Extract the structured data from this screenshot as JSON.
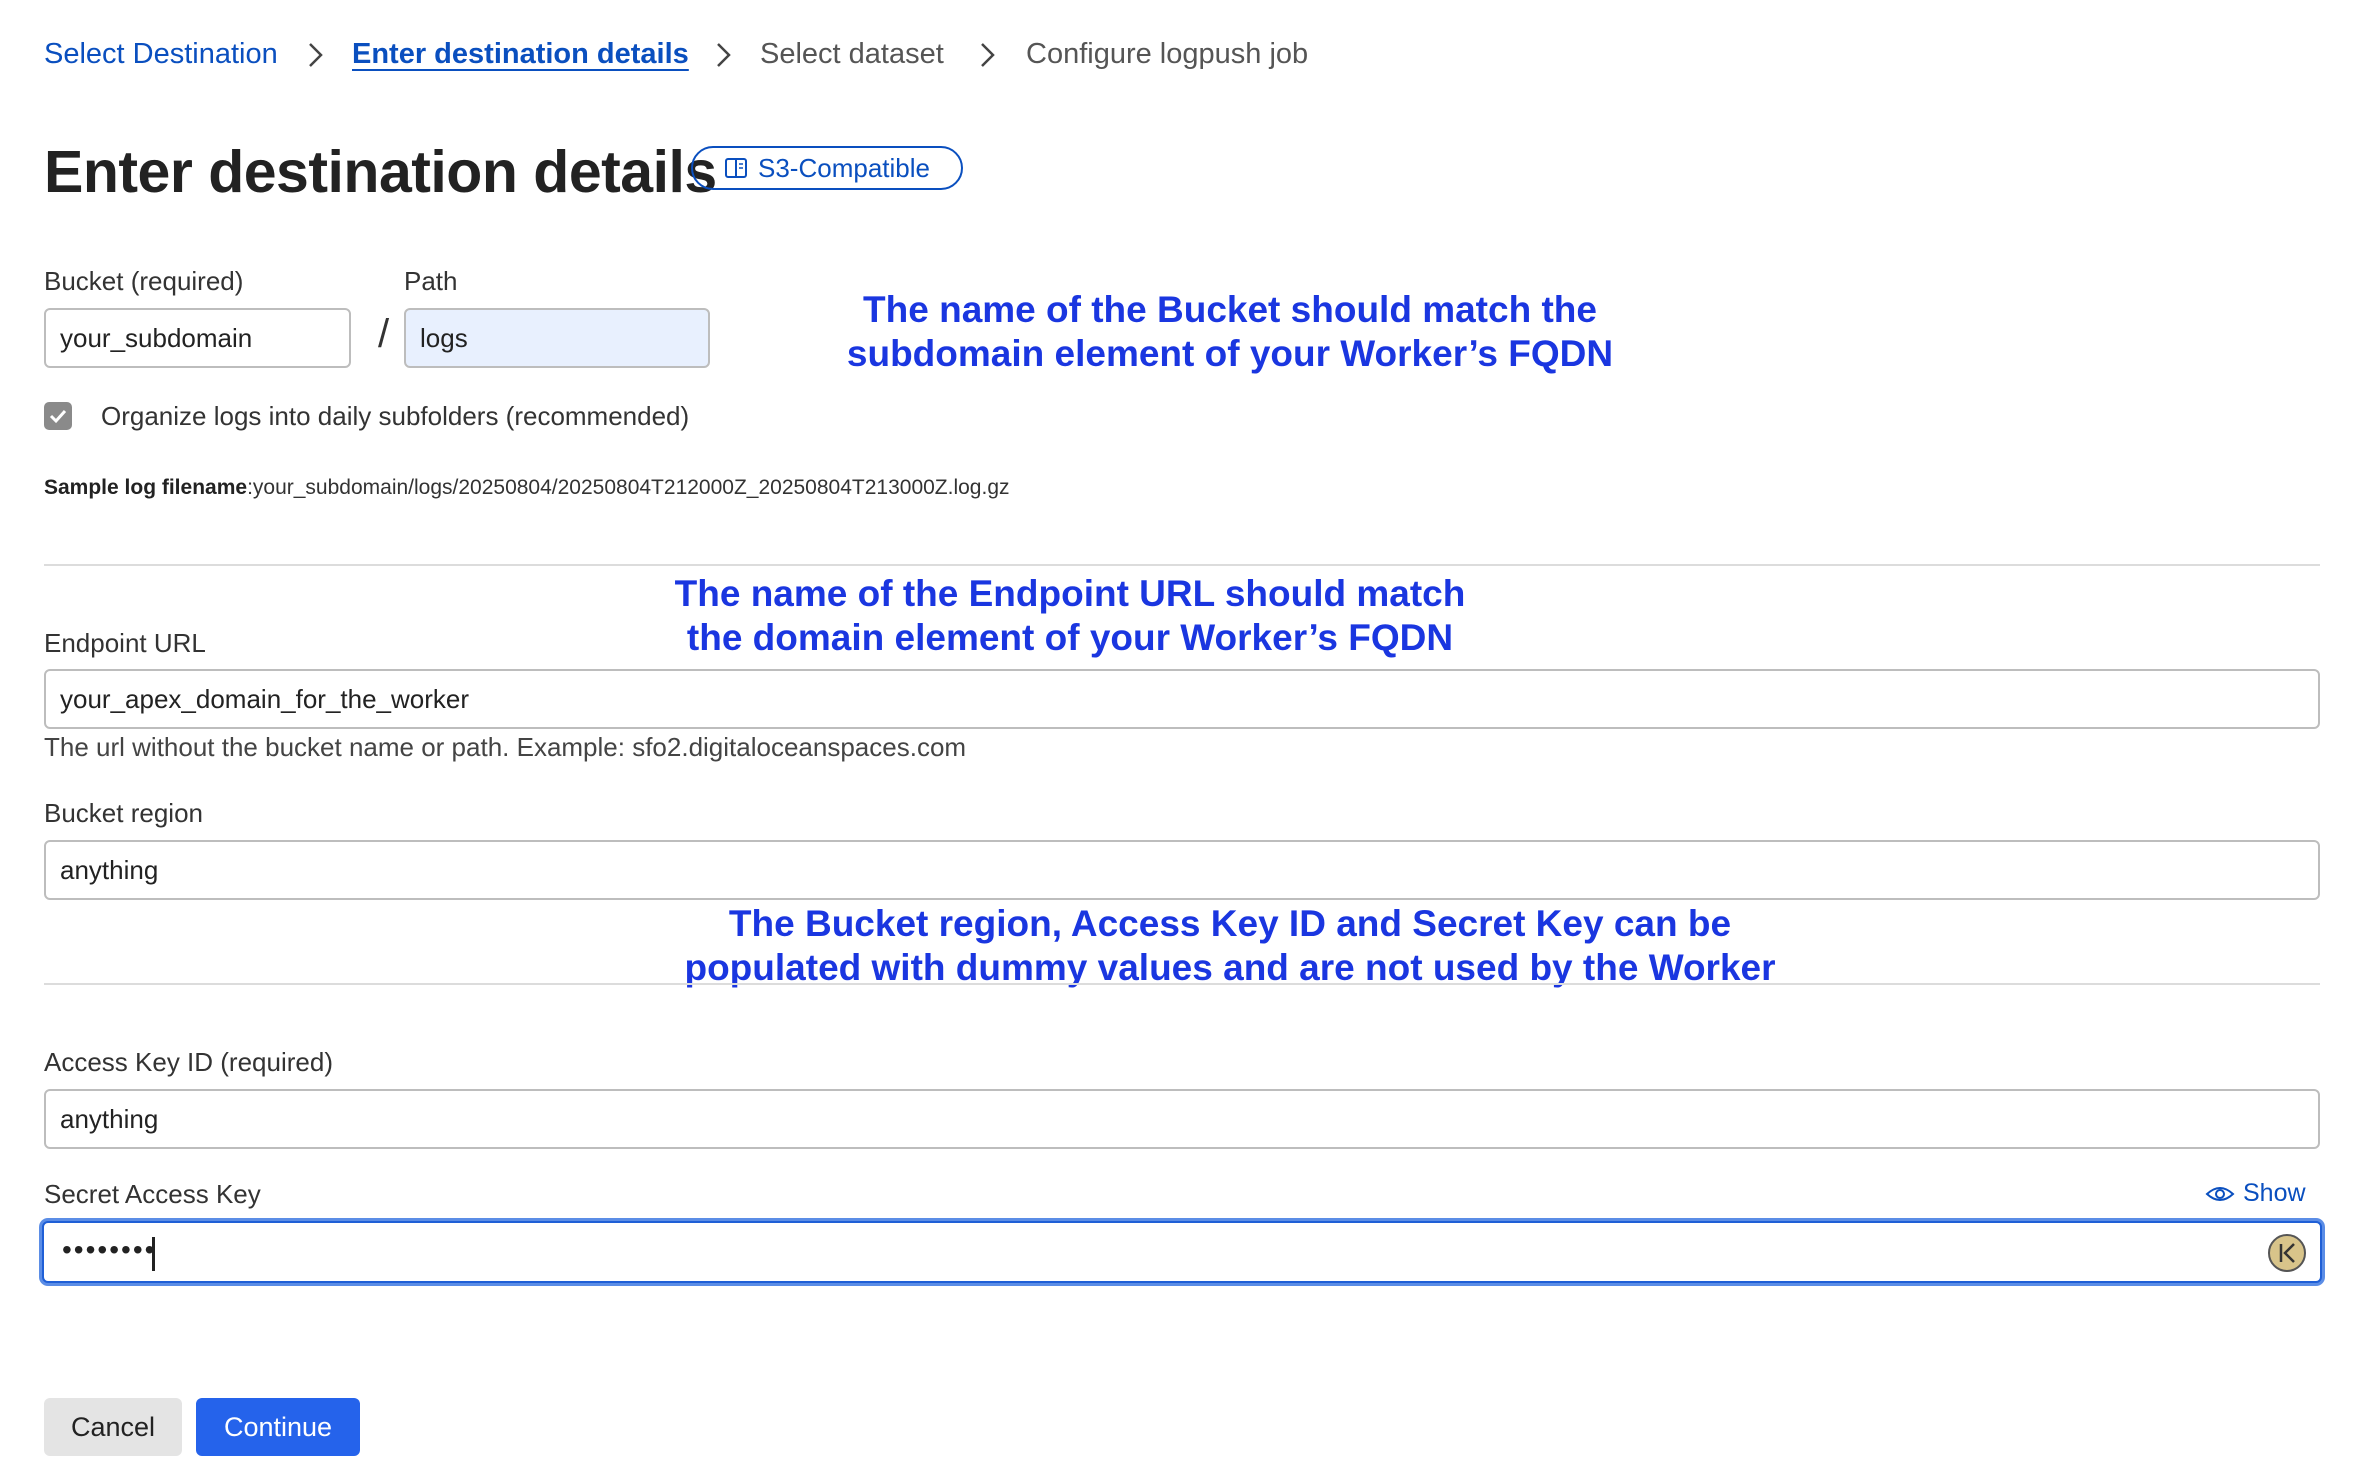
{
  "breadcrumb": {
    "items": [
      {
        "label": "Select Destination",
        "state": "link"
      },
      {
        "label": "Enter destination details",
        "state": "current"
      },
      {
        "label": "Select dataset",
        "state": "upcoming"
      },
      {
        "label": "Configure logpush job",
        "state": "upcoming"
      }
    ]
  },
  "header": {
    "title": "Enter destination details",
    "badge_label": "S3-Compatible",
    "badge_icon": "book-icon"
  },
  "bucket": {
    "label": "Bucket (required)",
    "value": "your_subdomain",
    "separator": "/"
  },
  "path": {
    "label": "Path",
    "value": "logs"
  },
  "daily_subfolders": {
    "label": "Organize logs into daily subfolders (recommended)",
    "checked": true
  },
  "sample_filename": {
    "label": "Sample log filename",
    "value": ":your_subdomain/logs/20250804/20250804T212000Z_20250804T213000Z.log.gz"
  },
  "endpoint": {
    "label": "Endpoint URL",
    "value": "your_apex_domain_for_the_worker",
    "help": "The url without the bucket name or path. Example: sfo2.digitaloceanspaces.com"
  },
  "region": {
    "label": "Bucket region",
    "value": "anything"
  },
  "access_key": {
    "label": "Access Key ID (required)",
    "value": "anything"
  },
  "secret_key": {
    "label": "Secret Access Key",
    "masked_value": "••••••••",
    "show_label": "Show",
    "show_icon": "eye-icon",
    "extension_icon": "keeper-icon"
  },
  "annotations": {
    "bucket_line1": "The name of the Bucket should match the",
    "bucket_line2": "subdomain element of your Worker’s FQDN",
    "endpoint_line1": "The name of the Endpoint URL should match",
    "endpoint_line2": "the domain element of your Worker’s FQDN",
    "region_line1": "The Bucket region, Access Key ID and Secret Key can be",
    "region_line2": "populated with dummy values and are not used by the Worker",
    "color": "#1a36e0"
  },
  "actions": {
    "cancel_label": "Cancel",
    "continue_label": "Continue"
  },
  "colors": {
    "link": "#0a4fbf",
    "primary_button": "#2563eb",
    "focus_border": "#1f5fd6"
  }
}
